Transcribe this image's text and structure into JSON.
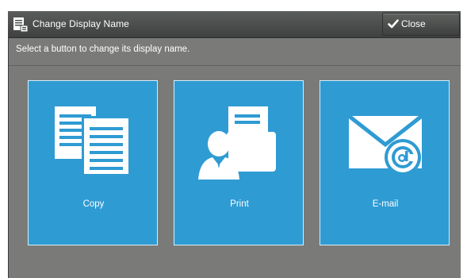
{
  "titlebar": {
    "title": "Change Display Name",
    "close_label": "Close",
    "icons": {
      "title": "display-name-icon",
      "close": "checkmark-icon"
    }
  },
  "instruction": "Select a button to change its display name.",
  "tiles": [
    {
      "label": "Copy",
      "icon": "copy-documents-icon"
    },
    {
      "label": "Print",
      "icon": "print-user-icon"
    },
    {
      "label": "E-mail",
      "icon": "email-envelope-icon"
    }
  ],
  "colors": {
    "tile_blue": "#2f9bd3",
    "background_gray": "#7a7b79",
    "titlebar_dark": "#4a4c4b"
  }
}
